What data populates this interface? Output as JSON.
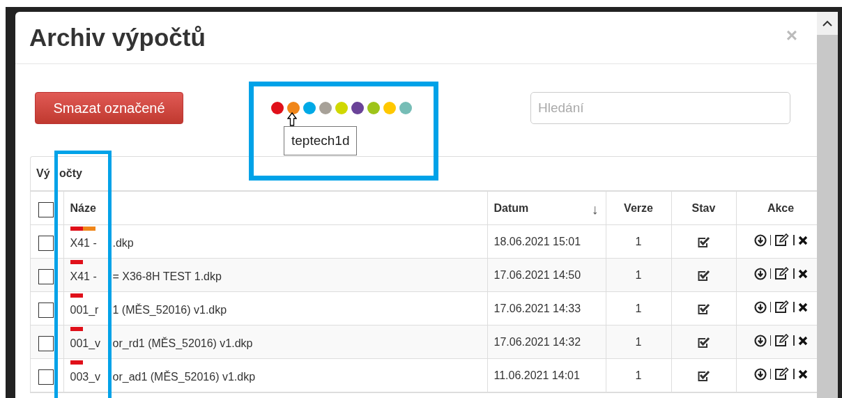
{
  "dialog": {
    "title": "Archiv výpočtů",
    "close": "×"
  },
  "toolbar": {
    "delete_button": "Smazat označené",
    "tag_colors": [
      {
        "color": "#e0101a",
        "hovered": false
      },
      {
        "color": "#f0861a",
        "hovered": true
      },
      {
        "color": "#00a9e6",
        "hovered": false
      },
      {
        "color": "#a7a198",
        "hovered": false
      },
      {
        "color": "#d0d800",
        "hovered": false
      },
      {
        "color": "#6a4398",
        "hovered": false
      },
      {
        "color": "#9ec41a",
        "hovered": false
      },
      {
        "color": "#ffc800",
        "hovered": false
      },
      {
        "color": "#76bdb6",
        "hovered": false
      }
    ],
    "tooltip": "teptech1d",
    "search": {
      "placeholder": "Hledání"
    }
  },
  "panel": {
    "title_parts": [
      "Vý",
      "očty"
    ],
    "table": {
      "all_selected": false,
      "columns": [
        {
          "label": "Náze"
        },
        {
          "label": "Datum",
          "sort": "↓"
        },
        {
          "label": "Verze"
        },
        {
          "label": "Stav"
        },
        {
          "label": "Akce"
        }
      ],
      "rows": [
        {
          "selected": false,
          "tags": [
            {
              "color": "#e0101a"
            },
            {
              "color": "#f0861a"
            }
          ],
          "name_parts": [
            "X41 -",
            ".dkp"
          ],
          "date": "18.06.2021 15:01",
          "version": "1",
          "done": true
        },
        {
          "selected": false,
          "tags": [
            {
              "color": "#e0101a"
            }
          ],
          "name_parts": [
            "X41 -",
            "= X36-8H TEST 1.dkp"
          ],
          "date": "17.06.2021 14:50",
          "version": "1",
          "done": true
        },
        {
          "selected": false,
          "tags": [
            {
              "color": "#e0101a"
            }
          ],
          "name_parts": [
            "001_r",
            "1 (MĚS_52016) v1.dkp"
          ],
          "date": "17.06.2021 14:33",
          "version": "1",
          "done": true
        },
        {
          "selected": false,
          "tags": [
            {
              "color": "#e0101a"
            }
          ],
          "name_parts": [
            "001_v",
            "or_rd1 (MĚS_52016) v1.dkp"
          ],
          "date": "17.06.2021 14:32",
          "version": "1",
          "done": true
        },
        {
          "selected": false,
          "tags": [
            {
              "color": "#e0101a"
            }
          ],
          "name_parts": [
            "003_v",
            "or_ad1 (MĚS_52016) v1.dkp"
          ],
          "date": "11.06.2021 14:01",
          "version": "1",
          "done": true
        }
      ]
    }
  }
}
